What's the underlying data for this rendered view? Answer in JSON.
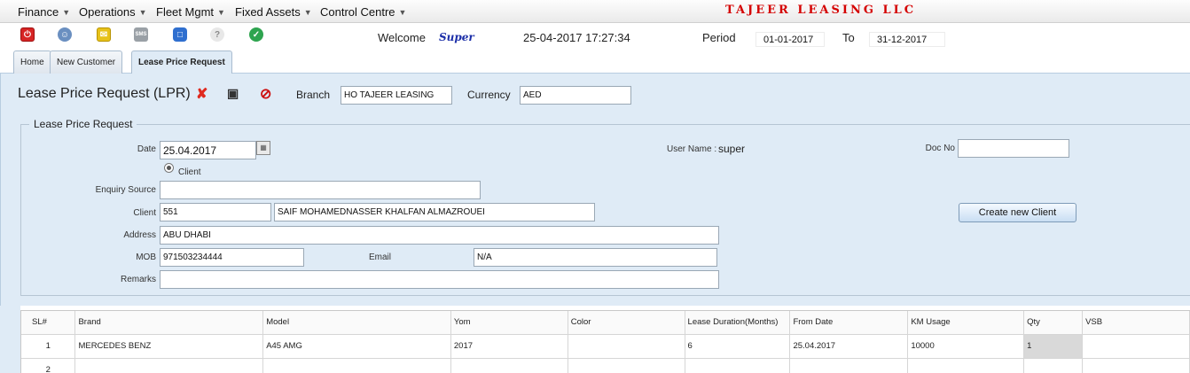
{
  "menu": {
    "items": [
      {
        "label": "Finance"
      },
      {
        "label": "Operations"
      },
      {
        "label": "Fleet Mgmt"
      },
      {
        "label": "Fixed Assets"
      },
      {
        "label": "Control Centre"
      }
    ],
    "company": "TAJEER LEASING LLC"
  },
  "toolbar": {
    "icons": [
      "power-icon",
      "users-icon",
      "mail-icon",
      "sms-icon",
      "chat-icon",
      "help-icon",
      "ok-check-icon"
    ],
    "sms_text": "SMS",
    "welcome_label": "Welcome",
    "user": "Super",
    "datetime": "25-04-2017 17:27:34",
    "period_label": "Period",
    "period_from": "01-01-2017",
    "to_label": "To",
    "period_to": "31-12-2017"
  },
  "tabs": [
    {
      "label": "Home"
    },
    {
      "label": "New Customer"
    },
    {
      "label": "Lease Price Request"
    }
  ],
  "form": {
    "title": "Lease Price Request (LPR)",
    "branch_label": "Branch",
    "branch_value": "HO TAJEER LEASING",
    "currency_label": "Currency",
    "currency_value": "AED",
    "legend": "Lease Price Request",
    "date_label": "Date",
    "date_value": "25.04.2017",
    "username_label": "User Name :",
    "username_value": "super",
    "docno_label": "Doc No",
    "docno_value": "",
    "radio_label": "Client",
    "enquiry_label": "Enquiry Source",
    "enquiry_value": "",
    "client_label": "Client",
    "client_code": "551",
    "client_name": "SAIF MOHAMEDNASSER KHALFAN ALMAZROUEI",
    "new_client_button": "Create new Client",
    "address_label": "Address",
    "address_value": "ABU DHABI",
    "mob_label": "MOB",
    "mob_value": "971503234444",
    "email_label": "Email",
    "email_value": "N/A",
    "remarks_label": "Remarks",
    "remarks_value": ""
  },
  "grid": {
    "columns": [
      "SL#",
      "Brand",
      "Model",
      "Yom",
      "Color",
      "Lease Duration(Months)",
      "From Date",
      "KM Usage",
      "Qty",
      "VSB"
    ],
    "rows": [
      [
        "1",
        "MERCEDES BENZ",
        "A45 AMG",
        "2017",
        "",
        "6",
        "25.04.2017",
        "10000",
        "1",
        ""
      ],
      [
        "2",
        "",
        "",
        "",
        "",
        "",
        "",
        "",
        "",
        ""
      ]
    ]
  },
  "colors": {
    "panel": "#dfebf6",
    "company_red": "#d40000",
    "user_blue": "#1b2ea8"
  }
}
